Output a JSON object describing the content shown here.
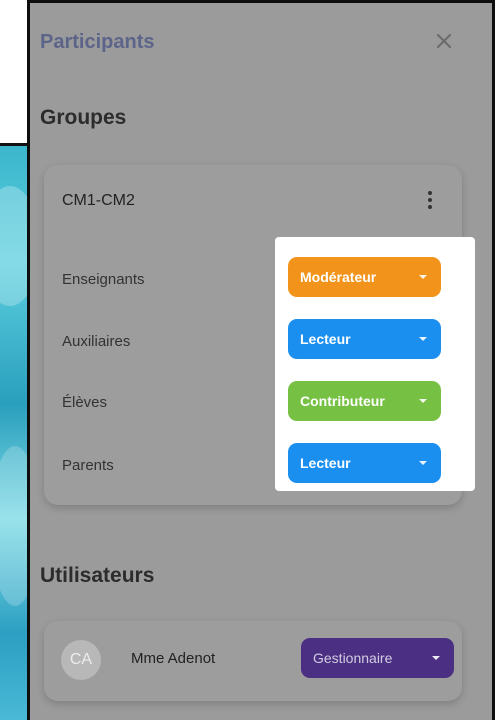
{
  "panel": {
    "title": "Participants",
    "close_icon": "close-icon"
  },
  "groups": {
    "section_title": "Groupes",
    "card": {
      "name": "CM1-CM2",
      "menu_icon": "kebab-icon",
      "roles": [
        {
          "label": "Enseignants",
          "value": "Modérateur",
          "color": "#f2941b"
        },
        {
          "label": "Auxiliaires",
          "value": "Lecteur",
          "color": "#1a8ff0"
        },
        {
          "label": "Élèves",
          "value": "Contributeur",
          "color": "#76c043"
        },
        {
          "label": "Parents",
          "value": "Lecteur",
          "color": "#1a8ff0"
        }
      ]
    }
  },
  "users": {
    "section_title": "Utilisateurs",
    "items": [
      {
        "initials": "CA",
        "name": "Mme Adenot",
        "role": "Gestionnaire",
        "role_color": "#4b2f83"
      }
    ]
  }
}
